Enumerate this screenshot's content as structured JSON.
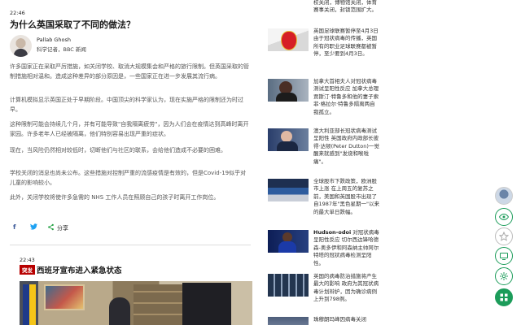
{
  "article": {
    "time": "22:46",
    "headline": "为什么英国采取了不同的做法？",
    "author_name": "Pallab Ghosh",
    "author_role": "科学记者，BBC 新闻",
    "paragraphs": [
      "许多国家正在采取严厉措施，如关闭学校、取消大规模集会和严格的旅行限制。但英国采取的管制措施相对温和。造成这种差异的部分原因是，一些国家正在进一步发展其流行病。",
      "计算机模拟显示英国正处于早期阶段。中国顶尖的科学家认为，现在实施严格的限制还为时过早。",
      "这种限制可能会持续几个月，并有可能导致\"自我隔离疲劳\"，因为人们会在疫情达到高峰时离开家园。许多老年人已经被隔离，他们特别容易出现严重的症状。",
      "现在，当风险仍然相对较低时，切断他们与社区的联系，会给他们造成不必要的困难。",
      "学校关闭的消息也尚未公布。这些措施对控制严重的流感疫情是有效的，但是Covid-19似乎对儿童的影响较小。",
      "此外，关闭学校将使许多急需的 NHS 工作人员在照顾自己的孩子时离开工作岗位。"
    ],
    "share_label": "分享"
  },
  "breaking": {
    "time": "22:43",
    "badge": "突发",
    "headline": "西班牙宣布进入紧急状态"
  },
  "sidebar": {
    "items": [
      {
        "bold": "",
        "text": "校关闭，博物馆关闭，体育赛事关闭，封锁范围扩大。"
      },
      {
        "bold": "",
        "text": "英国足球联赛暂停至4月3日 由于冠状病毒的传播，英国所有的职业足球联赛都被暂停，至少要到4月3日。"
      },
      {
        "bold": "",
        "text": "加拿大首相夫人对冠状病毒测试呈阳性反应 加拿大总理贾斯汀·特鲁多和他的妻子索菲·格拉尔·特鲁多隔离两自我孤立。"
      },
      {
        "bold": "",
        "text": "澳大利亚部长冠状病毒测试呈阳性 英国政府内政部长彼得·达顿(Peter Dutton)一觉醒来就感到\"发烧和喉咙痛\"。"
      },
      {
        "bold": "",
        "text": "全球股市下跌政策，欧洲股市上涨 在上周五的复苏之前，美国和英国股市出现了自1987年\"黑色星期一\"以来的最大单日跌幅。"
      },
      {
        "bold": "Hudson-odoi",
        "text": "对冠状病毒呈阳性反应 切尔西边锋哈德森-奥多伊和阿森纳主帅阿尔特塔的冠状病毒检测呈阳性。"
      },
      {
        "bold": "",
        "text": "英国的病毒防治措施将产生最大的影响 政府为其冠状病毒计划辩护，因为确诊病例上升到798例。"
      },
      {
        "bold": "",
        "text": "珠穆朗玛峰因病毒关闭"
      }
    ]
  },
  "toolbar": {
    "icons": [
      "avatar",
      "eye-icon",
      "star-icon",
      "screen-icon",
      "gear-icon",
      "grid-icon"
    ]
  }
}
